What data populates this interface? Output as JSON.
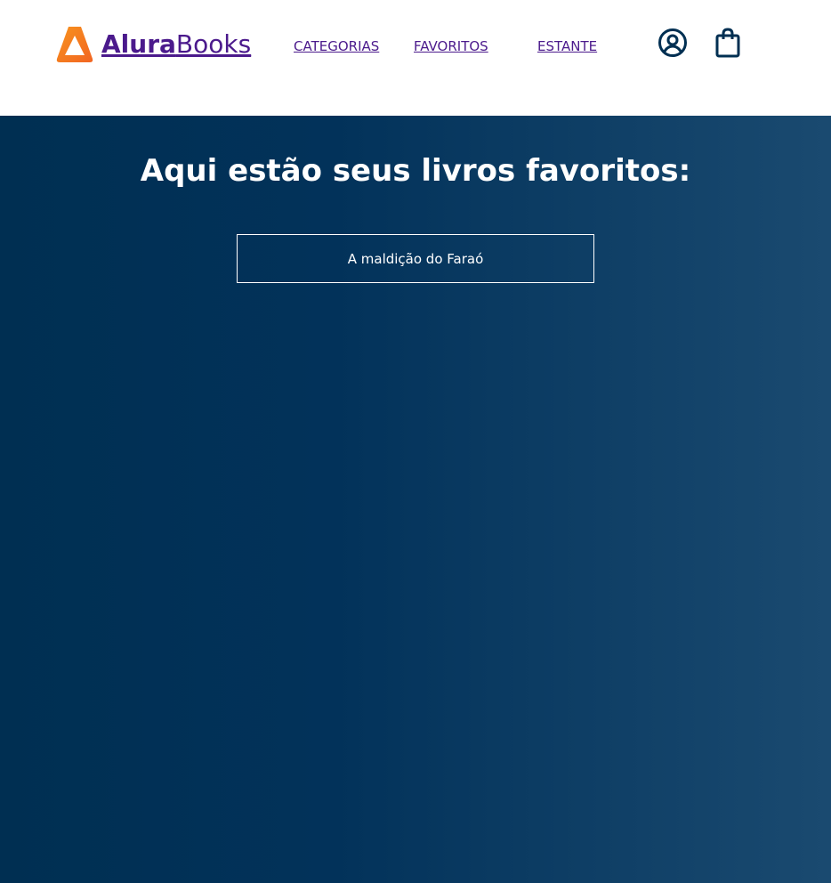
{
  "header": {
    "logo": {
      "bold_text": "Alura",
      "light_text": "Books",
      "mark_colors": [
        "#f7931e",
        "#f26522"
      ]
    },
    "nav": [
      {
        "label": "CATEGORIAS"
      },
      {
        "label": "FAVORITOS"
      },
      {
        "label": "ESTANTE"
      }
    ],
    "icons": {
      "user": "user-circle-icon",
      "bag": "shopping-bag-icon",
      "color": "#002f52"
    },
    "link_color": "#4b1a8c"
  },
  "main": {
    "title": "Aqui estão seus livros favoritos:",
    "books": [
      {
        "title": "A maldição do Faraó"
      }
    ],
    "background_colors": [
      "#002f52",
      "#1a4a70"
    ]
  }
}
